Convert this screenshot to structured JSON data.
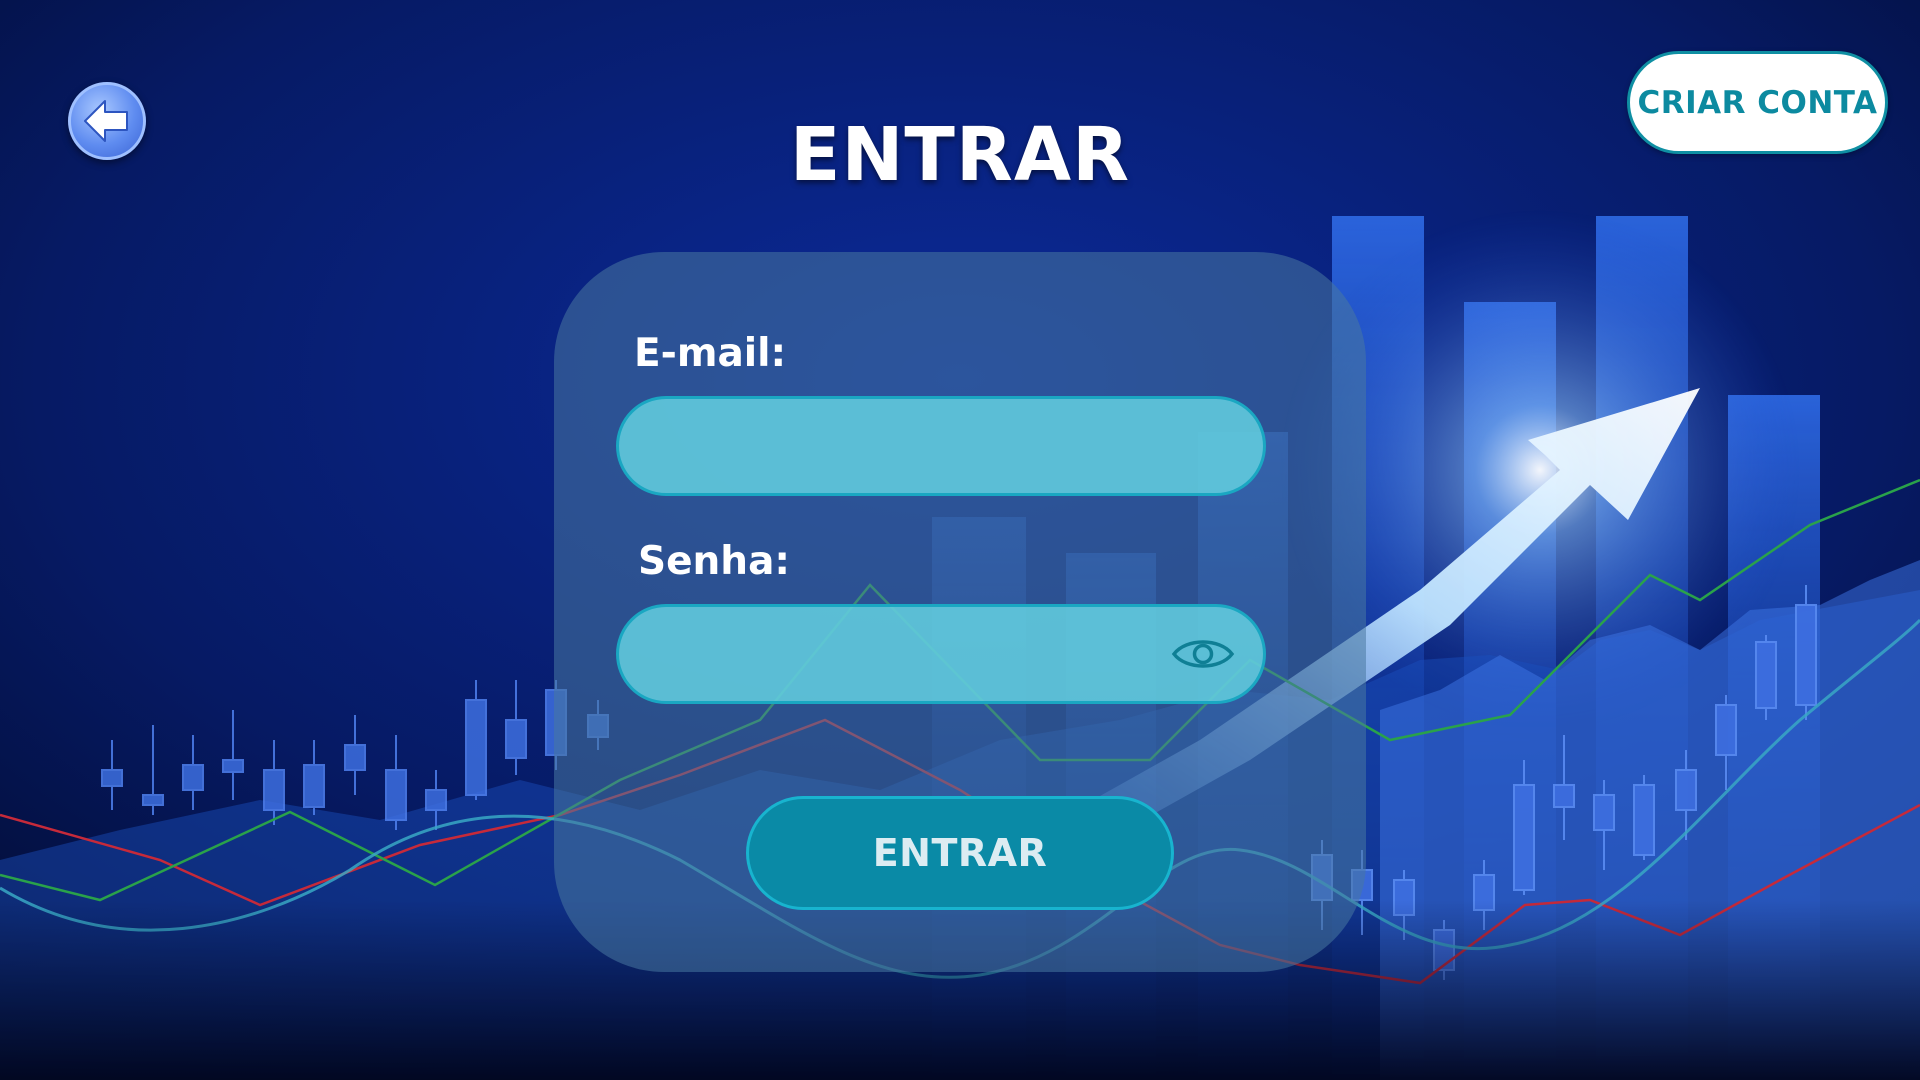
{
  "header": {
    "title": "ENTRAR",
    "create_account_label": "CRIAR CONTA",
    "back_icon": "back-arrow-icon"
  },
  "form": {
    "email_label": "E-mail:",
    "email_value": "",
    "password_label": "Senha:",
    "password_value": "",
    "password_toggle_icon": "eye-icon",
    "submit_label": "ENTRAR"
  },
  "colors": {
    "background": "#061a5a",
    "accent": "#0a8aa6",
    "input_fill": "#62cdde",
    "card": "#48789f"
  }
}
